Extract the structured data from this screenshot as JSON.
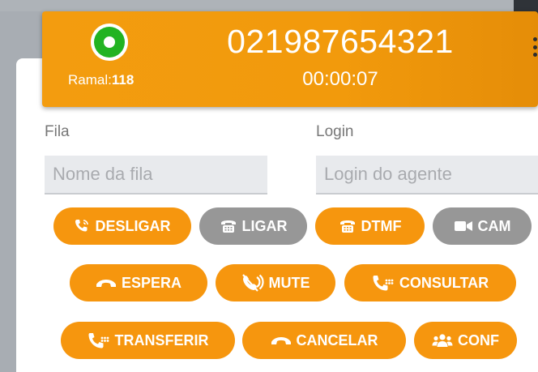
{
  "call": {
    "ramal_label": "Ramal:",
    "ramal_number": "118",
    "phone_number": "021987654321",
    "duration": "00:00:07",
    "status_color": "#22b322"
  },
  "form": {
    "queue_label": "Fila",
    "queue_placeholder": "Nome da fila",
    "login_label": "Login",
    "login_placeholder": "Login do agente"
  },
  "buttons": {
    "desligar": {
      "label": "DESLIGAR",
      "icon": "phone-ringing-icon",
      "state": "active"
    },
    "ligar": {
      "label": "LIGAR",
      "icon": "desk-phone-icon",
      "state": "disabled"
    },
    "dtmf": {
      "label": "DTMF",
      "icon": "desk-phone-icon",
      "state": "active"
    },
    "cam": {
      "label": "CAM",
      "icon": "video-camera-icon",
      "state": "disabled"
    },
    "espera": {
      "label": "ESPERA",
      "icon": "phone-hangup-icon",
      "state": "active"
    },
    "mute": {
      "label": "MUTE",
      "icon": "mute-icon",
      "state": "active"
    },
    "consultar": {
      "label": "CONSULTAR",
      "icon": "phone-keypad-icon",
      "state": "active"
    },
    "transferir": {
      "label": "TRANSFERIR",
      "icon": "phone-keypad-icon",
      "state": "active"
    },
    "cancelar": {
      "label": "CANCELAR",
      "icon": "phone-hangup-icon",
      "state": "active"
    },
    "conf": {
      "label": "CONF",
      "icon": "users-icon",
      "state": "active"
    }
  },
  "colors": {
    "accent": "#f6960e",
    "disabled": "#979797"
  }
}
